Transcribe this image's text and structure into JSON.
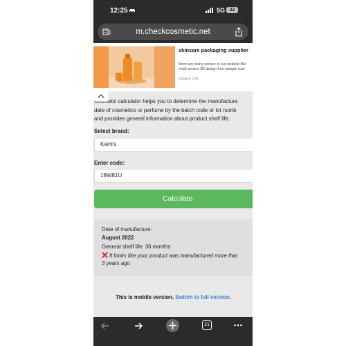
{
  "status_bar": {
    "time": "12:25",
    "car_icon": "car-icon",
    "network": "5G",
    "battery": "32"
  },
  "browser": {
    "url": "m.checkcosmetic.net",
    "reader_icon": "reader-icon",
    "share_icon": "share-icon"
  },
  "ad": {
    "title": "skincare packaging supplier",
    "description_line1": "there are many service in our website like",
    "description_line2": "mold service 3D design free sample cust",
    "domain": "xdpack.com"
  },
  "content": {
    "intro_line1": "Cosmetic calculator helps you to determine the manufacture",
    "intro_line2": "date of cosmetics or perfume by the batch code or lot numb",
    "intro_line3": "and provides general information about product shelf life.",
    "brand_label": "Select brand:",
    "brand_value": "Kiehl's",
    "code_label": "Enter code:",
    "code_value": "18W81U",
    "calculate_label": "Calculate"
  },
  "result": {
    "date_label": "Date of manufacture:",
    "date_value": "August 2022",
    "shelf_life": "General shelf life: 36 months",
    "warning_line1": "It looks like your product was manufactured more thar",
    "warning_line2": "3 years ago"
  },
  "footer": {
    "mobile_text": "This is mobile version.",
    "switch_link": "Switch to full version",
    "period": "."
  },
  "bottom_bar": {
    "tabs_count": "21"
  },
  "colors": {
    "calculate_button": "#5cb85c",
    "link": "#3a86c8",
    "warning_x": "#d9363e"
  }
}
